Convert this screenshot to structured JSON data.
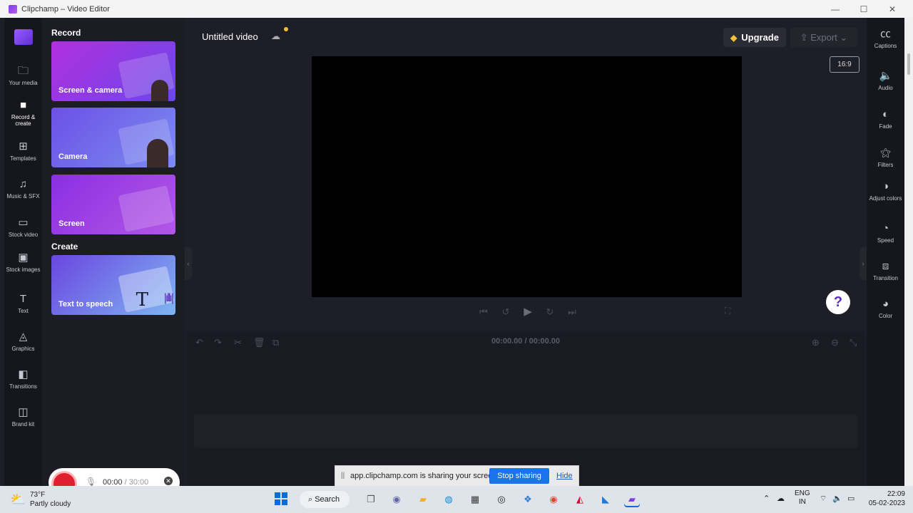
{
  "window": {
    "title": "Clipchamp – Video Editor",
    "minimize_glyph": "—",
    "maximize_glyph": "☐",
    "close_glyph": "✕"
  },
  "nav": {
    "items": [
      {
        "label": "Your media",
        "icon": "folder-icon",
        "glyph": "🗀"
      },
      {
        "label": "Record & create",
        "icon": "video-camera-icon",
        "glyph": "■"
      },
      {
        "label": "Templates",
        "icon": "templates-icon",
        "glyph": "⊞"
      },
      {
        "label": "Music & SFX",
        "icon": "music-note-icon",
        "glyph": "♫"
      },
      {
        "label": "Stock video",
        "icon": "film-icon",
        "glyph": "▭"
      },
      {
        "label": "Stock images",
        "icon": "image-icon",
        "glyph": "▣"
      },
      {
        "label": "Text",
        "icon": "text-icon",
        "glyph": "T"
      },
      {
        "label": "Graphics",
        "icon": "shapes-icon",
        "glyph": "◬"
      },
      {
        "label": "Transitions",
        "icon": "transitions-icon",
        "glyph": "◧"
      },
      {
        "label": "Brand kit",
        "icon": "brand-kit-icon",
        "glyph": "◫"
      }
    ]
  },
  "record_panel": {
    "record_heading": "Record",
    "create_heading": "Create",
    "cards": [
      {
        "label": "Screen & camera",
        "gradient": "linear-gradient(135deg,#b12fe0,#6a48e8)"
      },
      {
        "label": "Camera",
        "gradient": "linear-gradient(135deg,#6c50e6,#7b8cf0)"
      },
      {
        "label": "Screen",
        "gradient": "linear-gradient(135deg,#8a2fe2,#b357e6)"
      },
      {
        "label": "Text to speech",
        "gradient": "linear-gradient(135deg,#6a46e0,#7fb5f2)"
      }
    ],
    "recorder": {
      "elapsed": "00:00",
      "separator": " / ",
      "limit": "30:00",
      "mic_glyph": "🎙",
      "close_glyph": "✕"
    }
  },
  "header": {
    "project_title": "Untitled video",
    "cloud_glyph": "☁",
    "upgrade_label": "Upgrade",
    "upgrade_glyph": "◆",
    "export_label": "Export",
    "export_glyph": "⇪ ",
    "export_chevron": " ⌄"
  },
  "preview": {
    "aspect_ratio": "16:9",
    "help_glyph": "?",
    "fullscreen_glyph": "⛶",
    "playback_glyphs": [
      "⏮",
      "↺",
      "▶",
      "↻",
      "⏭"
    ]
  },
  "timeline": {
    "current_time": "00:00.00",
    "separator": " / ",
    "total_time": "00:00.00",
    "tool_glyphs": [
      "↶",
      "↷",
      "✂",
      "🗑",
      "⧉"
    ],
    "zoom_glyphs": [
      "⊕",
      "⊖",
      "⤡"
    ]
  },
  "right_tools": {
    "items": [
      {
        "label": "Captions",
        "icon": "captions-icon",
        "glyph": "㏄"
      },
      {
        "label": "Audio",
        "icon": "speaker-icon",
        "glyph": "🔈"
      },
      {
        "label": "Fade",
        "icon": "fade-icon",
        "glyph": "◐"
      },
      {
        "label": "Filters",
        "icon": "magic-wand-icon",
        "glyph": "⚝"
      },
      {
        "label": "Adjust colors",
        "icon": "contrast-icon",
        "glyph": "◑"
      },
      {
        "label": "Speed",
        "icon": "speedometer-icon",
        "glyph": "◔"
      },
      {
        "label": "Transition",
        "icon": "transition-icon",
        "glyph": "⧈"
      },
      {
        "label": "Color",
        "icon": "palette-icon",
        "glyph": "◕"
      }
    ]
  },
  "share_bar": {
    "grip_glyph": "||",
    "message": "app.clipchamp.com is sharing your screen.",
    "stop_label": "Stop sharing",
    "hide_label": "Hide"
  },
  "taskbar": {
    "weather_temp": "73°F",
    "weather_desc": "Partly cloudy",
    "weather_glyph": "⛅",
    "search_label": "Search",
    "search_glyph": "⌕ ",
    "apps": [
      {
        "icon": "task-view-icon",
        "glyph": "❐",
        "color": "#555555"
      },
      {
        "icon": "teams-chat-icon",
        "glyph": "◉",
        "color": "#6264a7"
      },
      {
        "icon": "file-explorer-icon",
        "glyph": "▰",
        "color": "#f2b01e"
      },
      {
        "icon": "edge-browser-icon",
        "glyph": "◍",
        "color": "#0f8bd6"
      },
      {
        "icon": "microsoft-store-icon",
        "glyph": "▦",
        "color": "#3a3a3a"
      },
      {
        "icon": "github-icon",
        "glyph": "◎",
        "color": "#222222"
      },
      {
        "icon": "python-icon",
        "glyph": "❖",
        "color": "#2b7bd0"
      },
      {
        "icon": "chrome-browser-icon",
        "glyph": "◉",
        "color": "#e0452e"
      },
      {
        "icon": "mcafee-icon",
        "glyph": "◭",
        "color": "#c8102e"
      },
      {
        "icon": "vscode-icon",
        "glyph": "◣",
        "color": "#1d7ad6"
      },
      {
        "icon": "clipchamp-icon",
        "glyph": "▰",
        "color": "#7b3fe4"
      }
    ],
    "tray_chevron": "⌃",
    "onedrive_glyph": "☁",
    "lang_line1": "ENG",
    "lang_line2": "IN",
    "wifi_glyph": "⌔",
    "volume_glyph": "🔈",
    "battery_glyph": "▭",
    "time": "22:09",
    "date": "05-02-2023"
  }
}
